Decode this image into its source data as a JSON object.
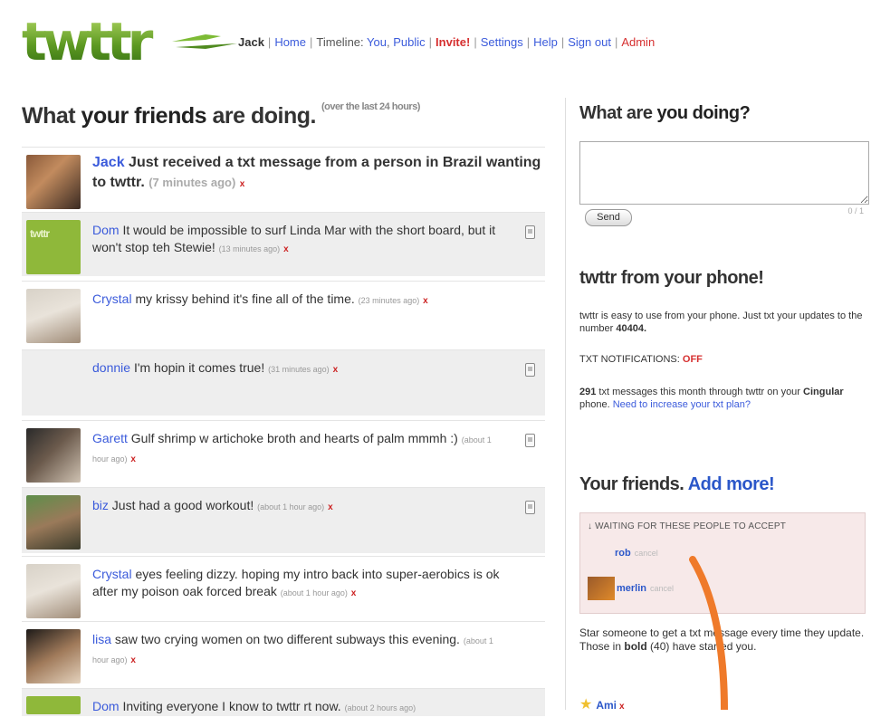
{
  "header": {
    "logo_text": "twttr",
    "user": "Jack",
    "nav": {
      "home": "Home",
      "timeline_label": "Timeline:",
      "you": "You",
      "public": "Public",
      "invite": "Invite!",
      "settings": "Settings",
      "help": "Help",
      "signout": "Sign out",
      "admin": "Admin"
    }
  },
  "main": {
    "title_pre": "What ",
    "title_bold": "your friends",
    "title_post": " are doing.",
    "title_note": "(over the last 24 hours)",
    "statuses": [
      {
        "user": "Jack",
        "text": "Just received a txt message from a person in Brazil wanting to twttr.",
        "time": "(7 minutes ago)",
        "x": "x"
      },
      {
        "user": "Dom",
        "text": "It would be impossible to surf Linda Mar with the short board, but it won't stop teh Stewie!",
        "time": "(13 minutes ago)",
        "x": "x"
      },
      {
        "user": "Crystal",
        "text": "my krissy behind it's fine all of the time.",
        "time": "(23 minutes ago)",
        "x": "x"
      },
      {
        "user": "donnie",
        "text": "I'm hopin it comes true!",
        "time": "(31 minutes ago)",
        "x": "x"
      },
      {
        "user": "Garett",
        "text": "Gulf shrimp w artichoke broth and hearts of palm mmmh :)",
        "time": "(about 1 hour ago)",
        "x": "x"
      },
      {
        "user": "biz",
        "text": "Just had a good workout!",
        "time": "(about 1 hour ago)",
        "x": "x"
      },
      {
        "user": "Crystal",
        "text": "eyes feeling dizzy. hoping my intro back into super-aerobics is ok after my poison oak forced break",
        "time": "(about 1 hour ago)",
        "x": "x"
      },
      {
        "user": "lisa",
        "text": "saw two crying women on two different subways this evening.",
        "time": "(about 1 hour ago)",
        "x": "x"
      },
      {
        "user": "Dom",
        "text": "Inviting everyone I know to twttr rt now.",
        "time": "(about 2 hours ago)",
        "x": ""
      }
    ]
  },
  "sidebar": {
    "doing_pre": "What are ",
    "doing_bold": "you doing?",
    "send": "Send",
    "counter": "0 / 1",
    "phone_title": "twttr from your phone!",
    "phone_text": "twttr is easy to use from your phone. Just txt your updates to the number ",
    "phone_number": "40404.",
    "notif_label": "TXT NOTIFICATIONS:",
    "notif_value": "OFF",
    "msg_count": "291",
    "msg_text": " txt messages this month through twttr on your ",
    "carrier": "Cingular",
    "msg_text2": " phone. ",
    "increase_link": "Need to increase your txt plan?",
    "friends_title": "Your friends.",
    "add_more": "Add more!",
    "waiting_head": "↓ WAITING FOR THESE PEOPLE TO ACCEPT",
    "pending": [
      {
        "name": "rob",
        "cancel": "cancel"
      },
      {
        "name": "merlin",
        "cancel": "cancel"
      }
    ],
    "star_text_a": "Star someone to get a txt message every time they update. Those in ",
    "star_bold": "bold",
    "star_text_b": " (40) have starred you.",
    "starred": {
      "name": "Ami",
      "x": "x"
    }
  },
  "colors": {
    "link": "#3b5bdb",
    "accent_red": "#d63030",
    "arrow": "#ef7a2a",
    "logo_green": "#6aa22a"
  }
}
